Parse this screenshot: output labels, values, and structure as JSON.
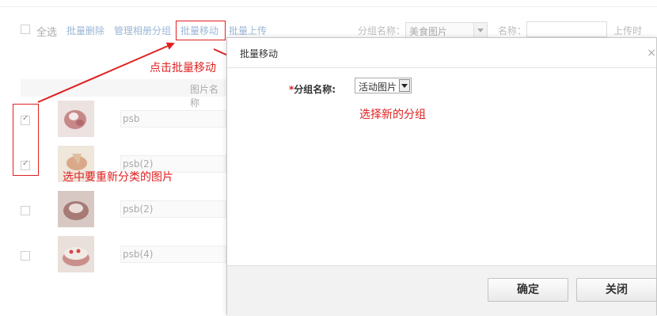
{
  "toolbar": {
    "select_all": "全选",
    "batch_delete": "批量删除",
    "manage_groups": "管理相册分组",
    "batch_move": "批量移动",
    "batch_upload": "批量上传",
    "group_name_label": "分组名称：",
    "group_select_value": "美食图片",
    "name_label": "名称：",
    "upload_time_label": "上传时间："
  },
  "table": {
    "header": "图片名称",
    "rows": [
      {
        "name": "psb",
        "checked": true
      },
      {
        "name": "psb(2)",
        "checked": true
      },
      {
        "name": "psb(2)",
        "checked": false
      },
      {
        "name": "psb(4)",
        "checked": false
      }
    ]
  },
  "dialog": {
    "title": "批量移动",
    "close": "×",
    "required_mark": "*",
    "field_label": "分组名称:",
    "select_value": "活动图片",
    "confirm": "确定",
    "close_button": "关闭"
  },
  "annotations": {
    "click_batch_move": "点击批量移动",
    "select_new_group": "选择新的分组",
    "select_images": "选中要重新分类的图片"
  },
  "colors": {
    "annotation_red": "#e02020",
    "link_blue": "#9ab6d6"
  }
}
